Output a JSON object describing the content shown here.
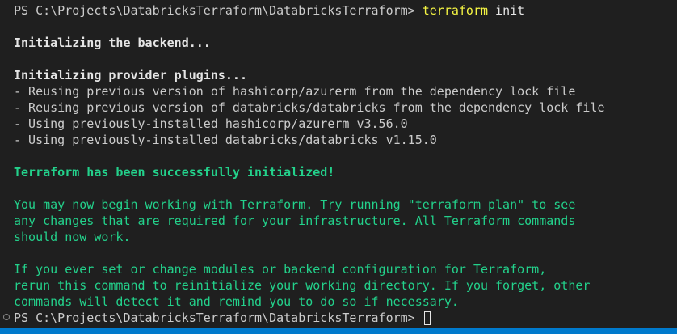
{
  "terminal": {
    "command_prompt": "PS C:\\Projects\\DatabricksTerraform\\DatabricksTerraform> ",
    "command_name": "terraform",
    "command_args": " init",
    "backend_heading": "Initializing the backend...",
    "provider_heading": "Initializing provider plugins...",
    "provider_lines": [
      "- Reusing previous version of hashicorp/azurerm from the dependency lock file",
      "- Reusing previous version of databricks/databricks from the dependency lock file",
      "- Using previously-installed hashicorp/azurerm v3.56.0",
      "- Using previously-installed databricks/databricks v1.15.0"
    ],
    "success_message": "Terraform has been successfully initialized!",
    "info_paragraph_1": [
      "You may now begin working with Terraform. Try running \"terraform plan\" to see",
      "any changes that are required for your infrastructure. All Terraform commands",
      "should now work."
    ],
    "info_paragraph_2": [
      "If you ever set or change modules or backend configuration for Terraform,",
      "rerun this command to reinitialize your working directory. If you forget, other",
      "commands will detect it and remind you to do so if necessary."
    ],
    "final_prompt": "PS C:\\Projects\\DatabricksTerraform\\DatabricksTerraform> "
  },
  "colors": {
    "background": "#1f1f1f",
    "text": "#cccccc",
    "green": "#23d18b",
    "yellow": "#f5f543",
    "status_bar": "#007acc"
  }
}
